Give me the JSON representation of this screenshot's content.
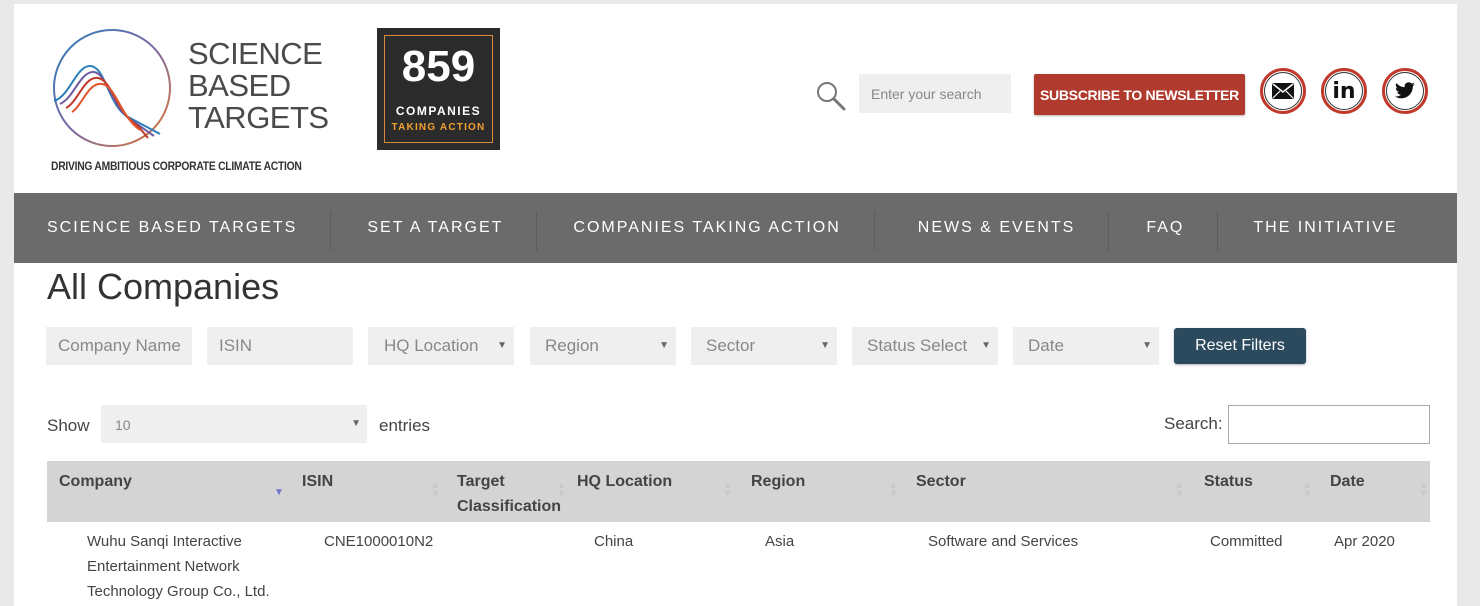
{
  "header": {
    "logo_lines": [
      "SCIENCE",
      "BASED",
      "TARGETS"
    ],
    "tagline": "DRIVING AMBITIOUS CORPORATE CLIMATE ACTION",
    "counter": {
      "number": "859",
      "line1": "COMPANIES",
      "line2": "TAKING ACTION"
    },
    "search_placeholder": "Enter your search",
    "subscribe_label": "SUBSCRIBE TO NEWSLETTER",
    "social_icons": [
      "mail-icon",
      "linkedin-icon",
      "twitter-icon"
    ],
    "linkedin_text": "in"
  },
  "nav": {
    "items": [
      "SCIENCE BASED TARGETS",
      "SET A TARGET",
      "COMPANIES TAKING ACTION",
      "NEWS & EVENTS",
      "FAQ",
      "THE INITIATIVE"
    ]
  },
  "main": {
    "title": "All Companies",
    "filters": {
      "company_name": "Company Name",
      "isin": "ISIN",
      "hq_location": "HQ Location",
      "region": "Region",
      "sector": "Sector",
      "status": "Status Select",
      "date": "Date",
      "reset_label": "Reset Filters"
    },
    "show_label": "Show",
    "entries_value": "10",
    "entries_label": "entries",
    "search_label": "Search:"
  },
  "table": {
    "columns": [
      "Company",
      "ISIN",
      "Target Classification",
      "HQ Location",
      "Region",
      "Sector",
      "Status",
      "Date"
    ],
    "rows": [
      {
        "company": "Wuhu Sanqi Interactive Entertainment Network Technology Group Co., Ltd.",
        "isin": "CNE1000010N2",
        "target_classification": "",
        "hq_location": "China",
        "region": "Asia",
        "sector": "Software and Services",
        "status": "Committed",
        "date": "Apr 2020"
      }
    ]
  },
  "colors": {
    "nav_bg": "#6b6b6b",
    "subscribe_bg": "#b03a2e",
    "reset_bg": "#2c4a5e",
    "table_header_bg": "#d4d4d4",
    "counter_accent": "#f0a030"
  }
}
